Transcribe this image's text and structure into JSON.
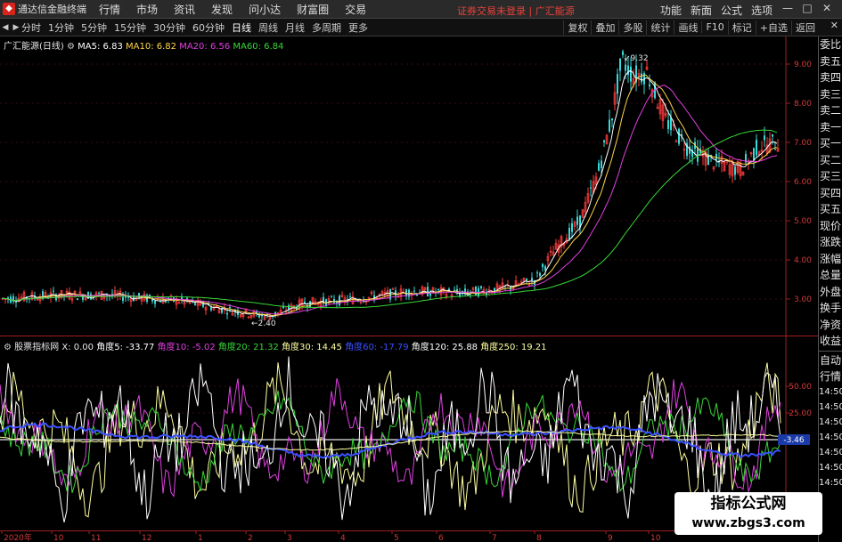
{
  "menubar": {
    "app_title": "通达信金融终端",
    "items": [
      "行情",
      "市场",
      "资讯",
      "发现",
      "问小达",
      "财富圈",
      "交易"
    ],
    "status": "证券交易未登录",
    "stock_name": "广汇能源",
    "right_items": [
      "功能",
      "新面",
      "公式",
      "选项"
    ],
    "window_buttons": [
      "—",
      "□",
      "✕"
    ]
  },
  "toolbar": {
    "periods": [
      "分时",
      "1分钟",
      "5分钟",
      "15分钟",
      "30分钟",
      "60分钟",
      "日线",
      "周线",
      "月线",
      "多周期",
      "更多"
    ],
    "active_period": "日线",
    "tools": [
      "复权",
      "叠加",
      "多股",
      "统计",
      "画线",
      "F10",
      "标记",
      "+自选",
      "返回"
    ],
    "close": "✕"
  },
  "price_chart": {
    "title": "广汇能源(日线)",
    "ma": [
      {
        "label": "MA5: 6.83",
        "color": "#ffffff"
      },
      {
        "label": "MA10: 6.82",
        "color": "#ffd34a"
      },
      {
        "label": "MA20: 6.56",
        "color": "#e040e0"
      },
      {
        "label": "MA60: 6.84",
        "color": "#38d838"
      }
    ],
    "yticks": [
      "9.00",
      "8.00",
      "7.00",
      "6.00",
      "5.00",
      "4.00",
      "3.00"
    ],
    "high_label": "9.32",
    "low_label": "2.40",
    "axis_color": "#d23a3a"
  },
  "indicator_chart": {
    "title": "股票指标网",
    "x_label": "X: 0.00",
    "angles": [
      {
        "label": "角度5: -33.77",
        "color": "#ffffff"
      },
      {
        "label": "角度10: -5.02",
        "color": "#e040e0"
      },
      {
        "label": "角度20: 21.32",
        "color": "#38d838"
      },
      {
        "label": "角度30: 14.45",
        "color": "#ffffa0"
      },
      {
        "label": "角度60: -17.79",
        "color": "#3a50ff"
      },
      {
        "label": "角度120: 25.88",
        "color": "#ffffff"
      },
      {
        "label": "角度250: 19.21",
        "color": "#ffffa0"
      }
    ],
    "yticks": [
      "50.00",
      "25.00"
    ],
    "current_value": "-3.46"
  },
  "xaxis": {
    "labels": [
      "2020年",
      "10",
      "11",
      "12",
      "1",
      "2",
      "3",
      "4",
      "5",
      "6",
      "7",
      "8",
      "9",
      "10"
    ]
  },
  "side_tabs": [
    "委比",
    "卖五",
    "卖四",
    "卖三",
    "卖二",
    "卖一",
    "买一",
    "买二",
    "买三",
    "买四",
    "买五",
    "现价",
    "涨跌",
    "涨幅",
    "总量",
    "外盘",
    "换手",
    "净资",
    "收益"
  ],
  "side_tabs_lower": [
    "自动",
    "行情",
    "14:50",
    "14:50",
    "14:50",
    "14:50",
    "14:50",
    "14:50",
    "14:50"
  ],
  "watermark": {
    "line1": "指标公式网",
    "line2": "www.zbgs3.com"
  }
}
